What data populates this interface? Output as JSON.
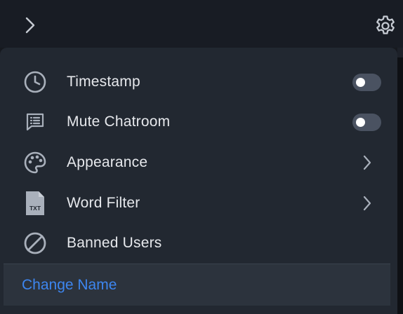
{
  "header": {
    "expand_icon": "chevron-right-icon",
    "settings_icon": "gear-icon"
  },
  "menu": {
    "items": [
      {
        "label": "Timestamp",
        "icon": "clock-icon",
        "control": "toggle",
        "enabled": false
      },
      {
        "label": "Mute Chatroom",
        "icon": "chat-list-icon",
        "control": "toggle",
        "enabled": false
      },
      {
        "label": "Appearance",
        "icon": "palette-icon",
        "control": "chevron"
      },
      {
        "label": "Word Filter",
        "icon": "txt-file-icon",
        "icon_text": "TXT",
        "control": "chevron"
      },
      {
        "label": "Banned Users",
        "icon": "ban-icon",
        "control": "none"
      }
    ],
    "footer_label": "Change Name"
  },
  "colors": {
    "accent": "#3d86f0",
    "panel": "#222831",
    "footer": "#2c333d",
    "toggle_off": "#4a5261",
    "icon": "#a9b0bb"
  }
}
